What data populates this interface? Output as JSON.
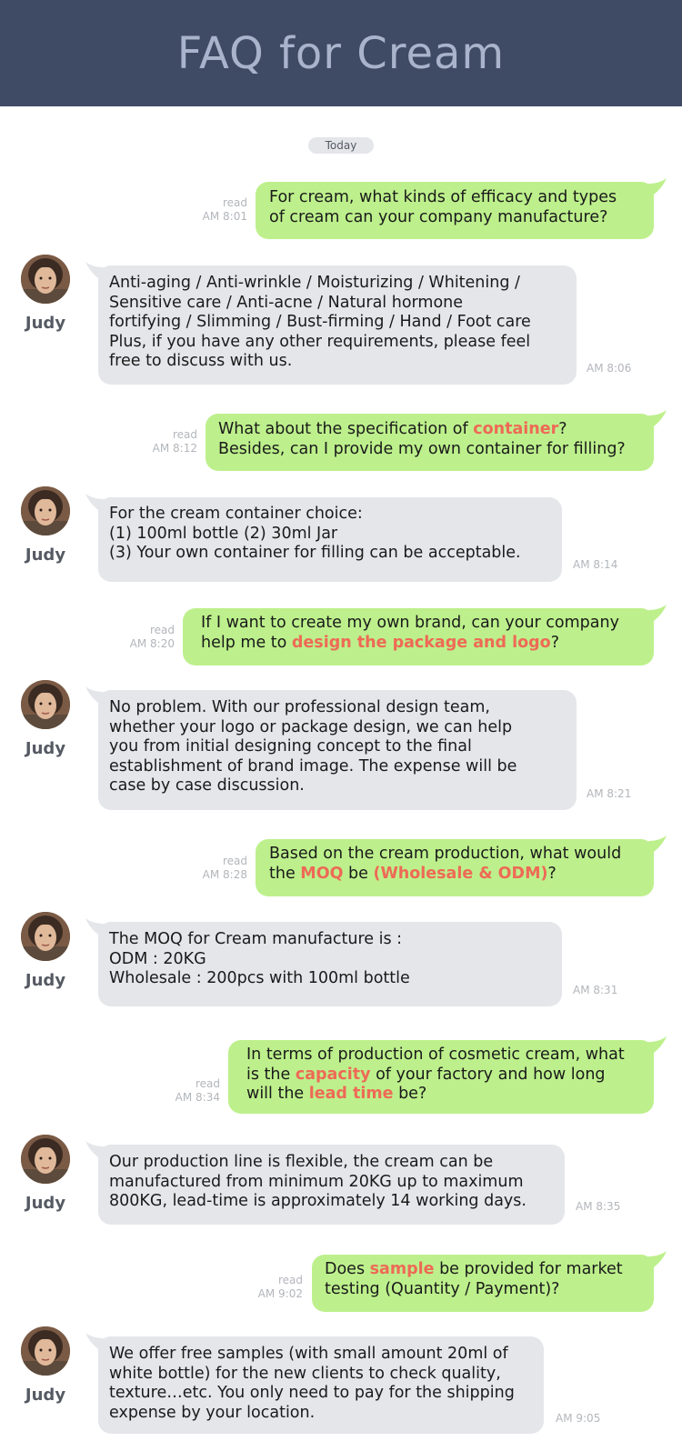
{
  "title": "FAQ for Cream",
  "date_label": "Today",
  "read_label": "read",
  "agent_name": "Judy",
  "colors": {
    "header_bg": "#3f4a65",
    "question_bubble": "#bdf08c",
    "answer_bubble": "#e4e6ea",
    "highlight": "#ee6a56"
  },
  "messages": [
    {
      "time": "AM 8:01",
      "lines": [
        [
          "For cream, what kinds of efficacy and types"
        ],
        [
          "of cream can your company manufacture?"
        ]
      ]
    },
    {
      "time": "AM 8:06",
      "lines": [
        [
          "Anti-aging / Anti-wrinkle / Moisturizing / Whitening /"
        ],
        [
          "Sensitive care / Anti-acne / Natural hormone"
        ],
        [
          "fortifying / Slimming / Bust-firming / Hand / Foot care"
        ],
        [
          "Plus, if you have any other requirements, please feel"
        ],
        [
          "free to discuss with us."
        ]
      ]
    },
    {
      "time": "AM 8:12",
      "lines": [
        [
          "What about the specification of ",
          "container",
          "?"
        ],
        [
          "Besides, can I provide my own container for filling?"
        ]
      ]
    },
    {
      "time": "AM 8:14",
      "lines": [
        [
          "For the cream container choice:"
        ],
        [
          "(1) 100ml bottle (2) 30ml Jar"
        ],
        [
          "(3) Your own container for filling can be acceptable."
        ]
      ]
    },
    {
      "time": "AM 8:20",
      "lines": [
        [
          "If I want to create my own brand, can your company"
        ],
        [
          "help me to ",
          "design the package and logo",
          "?"
        ]
      ]
    },
    {
      "time": "AM 8:21",
      "lines": [
        [
          "No problem. With our professional design team,"
        ],
        [
          "whether your logo or package design, we can help"
        ],
        [
          "you from initial designing concept to the final"
        ],
        [
          "establishment of brand image. The expense will be"
        ],
        [
          "case by case discussion."
        ]
      ]
    },
    {
      "time": "AM 8:28",
      "lines": [
        [
          "Based on the cream production, what would"
        ],
        [
          "the ",
          "MOQ",
          " be ",
          "(Wholesale & ODM)",
          "?"
        ]
      ]
    },
    {
      "time": "AM 8:31",
      "lines": [
        [
          "The MOQ for Cream manufacture is :"
        ],
        [
          "ODM : 20KG"
        ],
        [
          "Wholesale : 200pcs with 100ml bottle"
        ]
      ]
    },
    {
      "time": "AM 8:34",
      "lines": [
        [
          "In terms of production of cosmetic cream, what"
        ],
        [
          "is the ",
          "capacity",
          " of your factory and how long"
        ],
        [
          "will the ",
          "lead time",
          " be?"
        ]
      ]
    },
    {
      "time": "AM 8:35",
      "lines": [
        [
          "Our production line is flexible, the cream can be"
        ],
        [
          "manufactured from minimum 20KG up to maximum"
        ],
        [
          "800KG, lead-time is approximately 14 working days."
        ]
      ]
    },
    {
      "time": "AM 9:02",
      "lines": [
        [
          "Does ",
          "sample",
          " be provided for market"
        ],
        [
          "testing (Quantity / Payment)?"
        ]
      ]
    },
    {
      "time": "AM 9:05",
      "lines": [
        [
          "We offer free samples (with small amount 20ml of"
        ],
        [
          "white bottle) for the new clients to check quality,"
        ],
        [
          "texture…etc. You only need to pay for the shipping"
        ],
        [
          "expense by your location."
        ]
      ]
    }
  ]
}
